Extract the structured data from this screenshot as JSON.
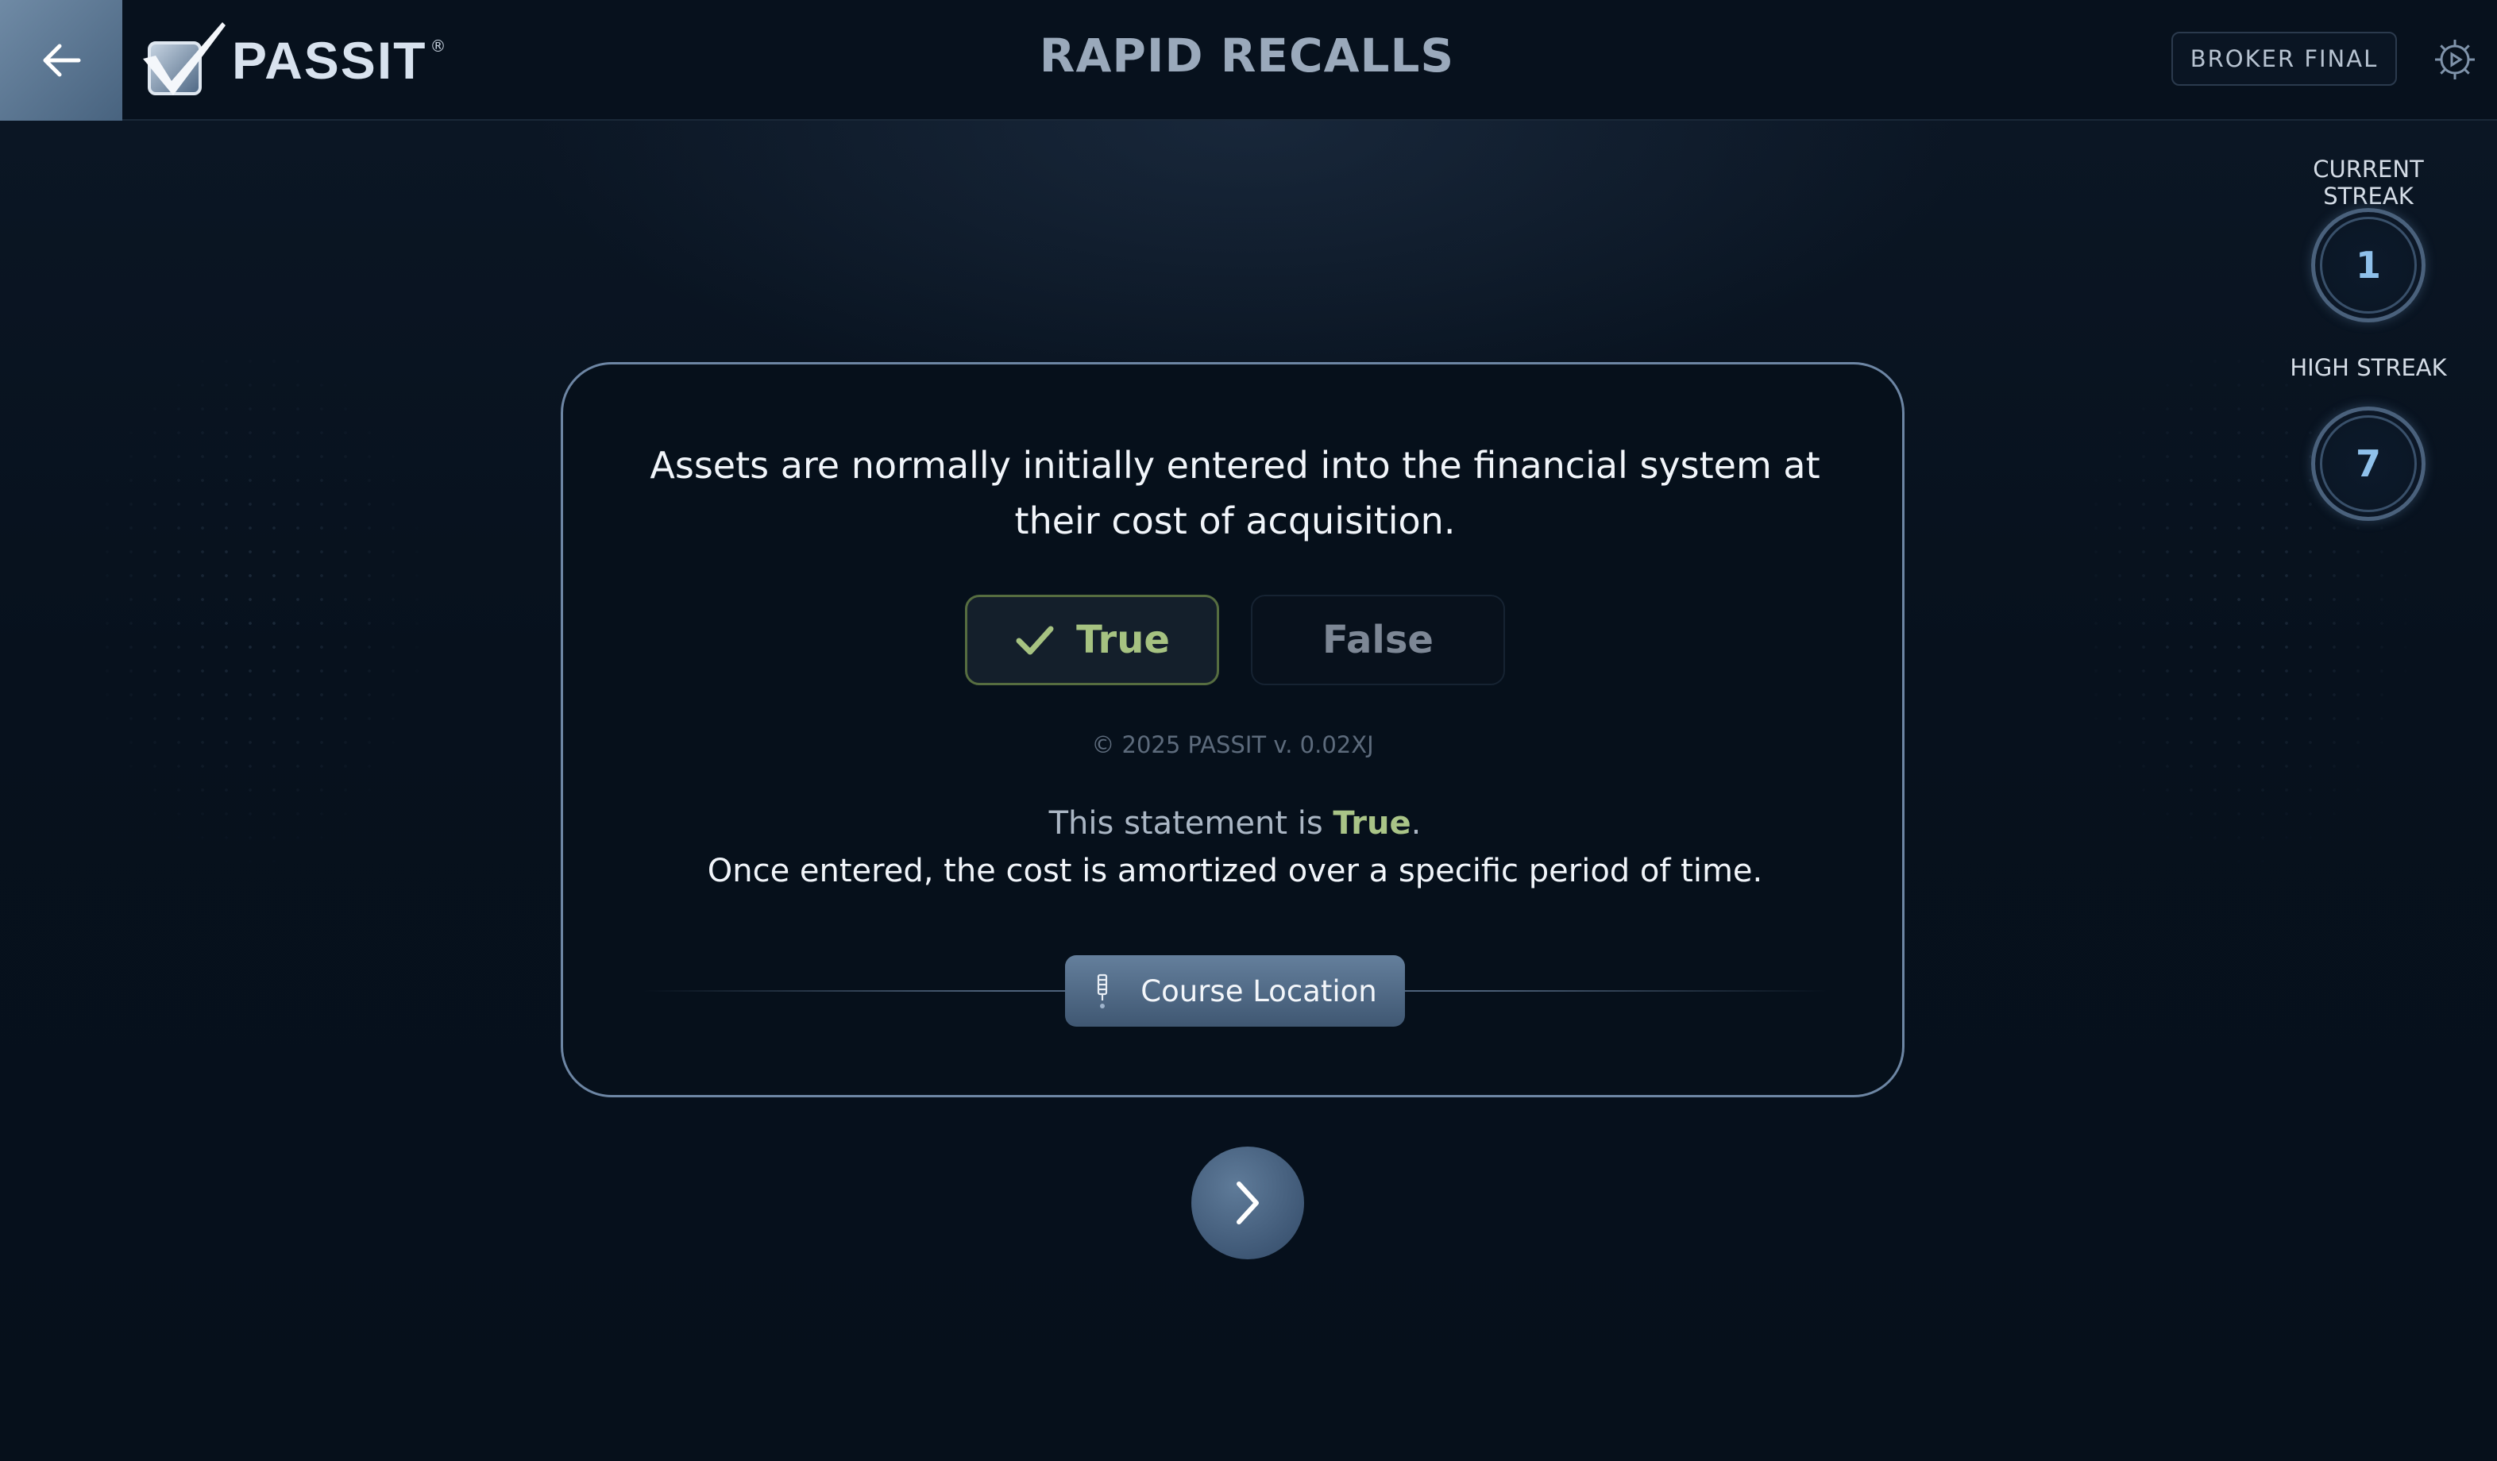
{
  "header": {
    "back_icon": "arrow-left-icon",
    "logo_text": "PASSIT",
    "logo_reg": "®",
    "title": "RAPID RECALLS",
    "exam_badge": "BROKER FINAL",
    "settings_icon": "gear-icon"
  },
  "streaks": {
    "current_label": "CURRENT STREAK",
    "current_value": "1",
    "high_label": "HIGH STREAK",
    "high_value": "7"
  },
  "card": {
    "question": "Assets are normally initially entered into the financial system at their cost of acquisition.",
    "answers": [
      {
        "label": "True",
        "selected": true
      },
      {
        "label": "False",
        "selected": false
      }
    ],
    "copyright": "© 2025 PASSIT v. 0.02XJ",
    "result_prefix": "This statement is ",
    "result_answer": "True",
    "result_suffix": ".",
    "explanation": "Once entered, the cost is amortized over a specific period of time.",
    "course_location_label": "Course Location"
  },
  "navigation": {
    "next_icon": "chevron-right-icon"
  },
  "colors": {
    "background": "#07101c",
    "accent": "#6d86a4",
    "correct": "#a9c487",
    "streak_value": "#8fc0ea"
  }
}
